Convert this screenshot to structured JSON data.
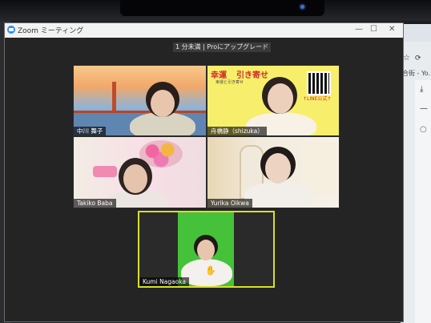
{
  "window": {
    "title": "Zoom ミーティング"
  },
  "banner": {
    "text": "1 分未満 | Proにアップグレード"
  },
  "tiles": [
    {
      "name": "中川 舞子"
    },
    {
      "name": "舟橋静（shizuka）"
    },
    {
      "name": "Takiko Baba"
    },
    {
      "name": "Yurika  Oikwa"
    },
    {
      "name": "Kumi Nagaoka"
    }
  ],
  "tile2": {
    "heading_left": "幸運",
    "heading_right": "引き寄せ",
    "small_text": "幸運と引き寄せ",
    "line_label": "↑LINE公式↑"
  },
  "browser": {
    "snippet": "合街 - Yo..."
  },
  "colors": {
    "active_speaker": "#d9e021",
    "zoom_blue": "#2d8cff"
  }
}
